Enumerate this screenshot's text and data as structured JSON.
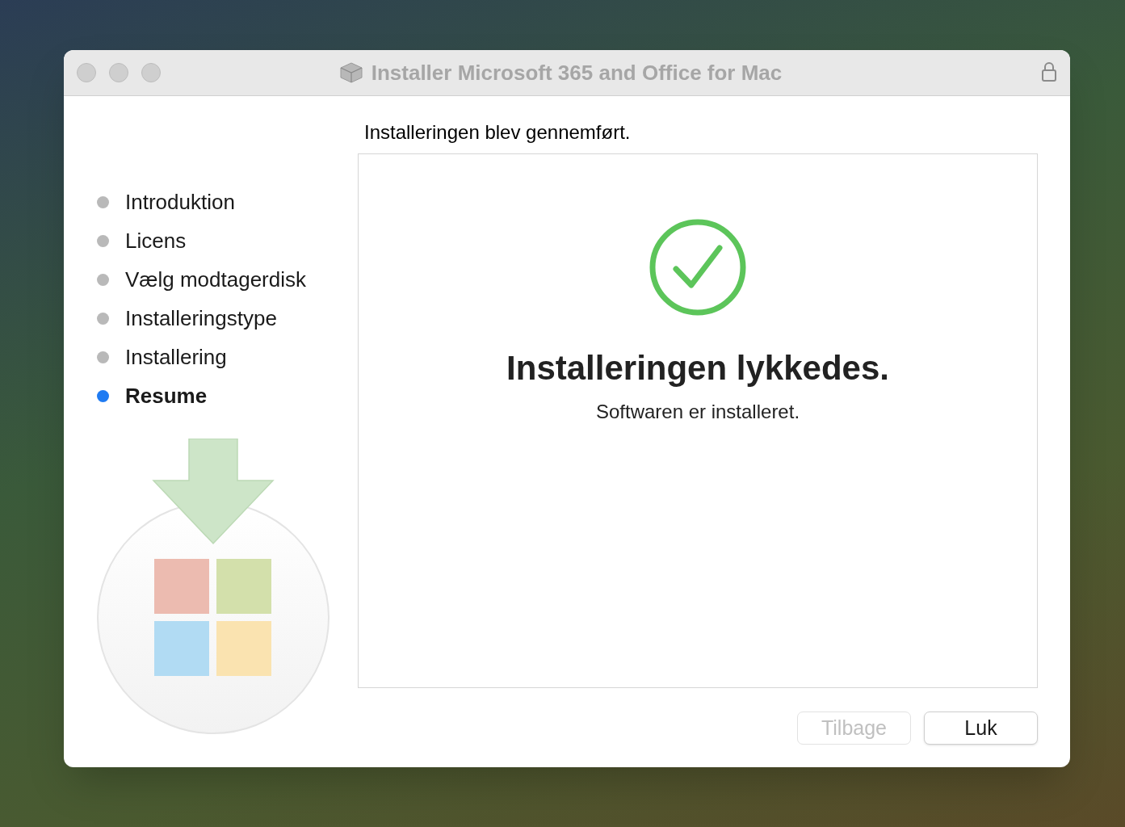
{
  "window": {
    "title": "Installer Microsoft 365 and Office for Mac"
  },
  "steps": [
    {
      "label": "Introduktion",
      "selected": false
    },
    {
      "label": "Licens",
      "selected": false
    },
    {
      "label": "Vælg modtagerdisk",
      "selected": false
    },
    {
      "label": "Installeringstype",
      "selected": false
    },
    {
      "label": "Installering",
      "selected": false
    },
    {
      "label": "Resume",
      "selected": true
    }
  ],
  "heading": "Installeringen blev gennemført.",
  "result": {
    "title": "Installeringen lykkedes.",
    "message": "Softwaren er installeret."
  },
  "buttons": [
    {
      "label": "Tilbage",
      "disabled": true
    },
    {
      "label": "Luk",
      "disabled": false
    }
  ]
}
